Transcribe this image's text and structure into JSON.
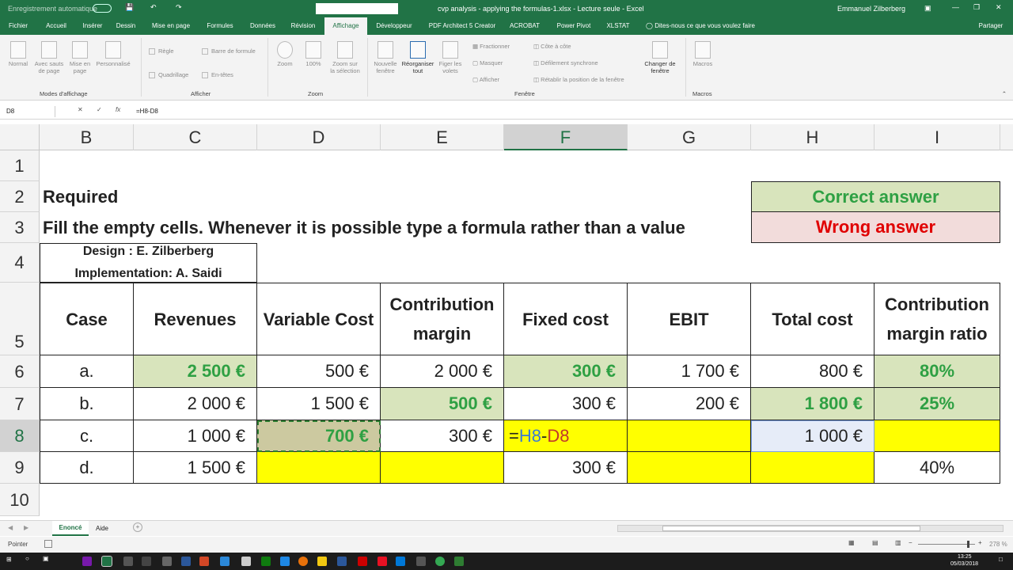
{
  "titlebar": {
    "autosave": "Enregistrement automatique",
    "title": "cvp analysis - applying the formulas-1.xlsx  -  Lecture seule  -  Excel",
    "user": "Emmanuel Zilberberg"
  },
  "tabs": [
    "Fichier",
    "Accueil",
    "Insérer",
    "Dessin",
    "Mise en page",
    "Formules",
    "Données",
    "Révision",
    "Affichage",
    "Développeur",
    "PDF Architect 5 Creator",
    "ACROBAT",
    "Power Pivot",
    "XLSTAT"
  ],
  "active_tab": "Affichage",
  "tell_me": "Dites-nous ce que vous voulez faire",
  "share": "Partager",
  "ribbon": {
    "normal": "Normal",
    "avec_sauts": "Avec sauts\nde page",
    "mise_en_page": "Mise en\npage",
    "personnalise": "Personnalisé",
    "modes_group": "Modes d'affichage",
    "regle": "Règle",
    "barre_formule": "Barre de formule",
    "quadrillage": "Quadrillage",
    "en_tetes": "En-têtes",
    "afficher_group": "Afficher",
    "zoom": "Zoom",
    "zoom100": "100%",
    "zoom_sel": "Zoom sur\nla sélection",
    "zoom_group": "Zoom",
    "nouvelle_fenetre": "Nouvelle\nfenêtre",
    "reorganiser": "Réorganiser\ntout",
    "figer": "Figer les\nvolets",
    "fractionner": "Fractionner",
    "masquer": "Masquer",
    "afficher": "Afficher",
    "cote_a_cote": "Côte à côte",
    "defilement": "Défilement synchrone",
    "retablir": "Rétablir la position de la fenêtre",
    "changer_fenetre": "Changer de\nfenêtre",
    "fenetre_group": "Fenêtre",
    "macros": "Macros",
    "macros_group": "Macros"
  },
  "formula_bar": {
    "name_box": "D8",
    "formula": "=H8-D8"
  },
  "columns": [
    "B",
    "C",
    "D",
    "E",
    "F",
    "G",
    "H",
    "I"
  ],
  "rows": [
    "1",
    "2",
    "3",
    "4",
    "5",
    "6",
    "7",
    "8",
    "9",
    "10"
  ],
  "sheet": {
    "required": "Required",
    "instruction": "Fill the empty cells. Whenever it is possible type a formula rather than a value",
    "design": "Design :  E. Zilberberg",
    "implementation": "Implementation: A. Saidi",
    "correct": "Correct answer",
    "wrong": "Wrong answer",
    "headers": [
      "Case",
      "Revenues",
      "Variable Cost",
      "Contribution margin",
      "Fixed cost",
      "EBIT",
      "Total cost",
      "Contribution margin ratio"
    ],
    "data": [
      [
        "a.",
        "2 500 €",
        "500 €",
        "2 000 €",
        "300 €",
        "1 700 €",
        "800 €",
        "80%"
      ],
      [
        "b.",
        "2 000 €",
        "1 500 €",
        "500 €",
        "300 €",
        "200 €",
        "1 800 €",
        "25%"
      ],
      [
        "c.",
        "1 000 €",
        "700 €",
        "300 €",
        "",
        "",
        "1 000 €",
        ""
      ],
      [
        "d.",
        "1 500 €",
        "",
        "",
        "300 €",
        "",
        "",
        "40%"
      ]
    ],
    "formula_edit": {
      "eq": "=",
      "ref1": "H8",
      "minus": "-",
      "ref2": "D8"
    }
  },
  "colors": {
    "correct_bg": "#d8e4bc",
    "correct_text": "#2ea043",
    "wrong_bg": "#f2dcdb",
    "wrong_text": "#e00000",
    "empty_fill": "#ffff00",
    "excel_green": "#217346",
    "ref_blue": "#3a7bd5",
    "ref_red": "#c0392b"
  },
  "sheet_tabs": [
    "Enoncé",
    "Aide"
  ],
  "active_sheet": "Enoncé",
  "status": {
    "mode": "Pointer",
    "zoom": "278 %"
  },
  "taskbar": {
    "time": "13:25",
    "date": "05/03/2018"
  }
}
